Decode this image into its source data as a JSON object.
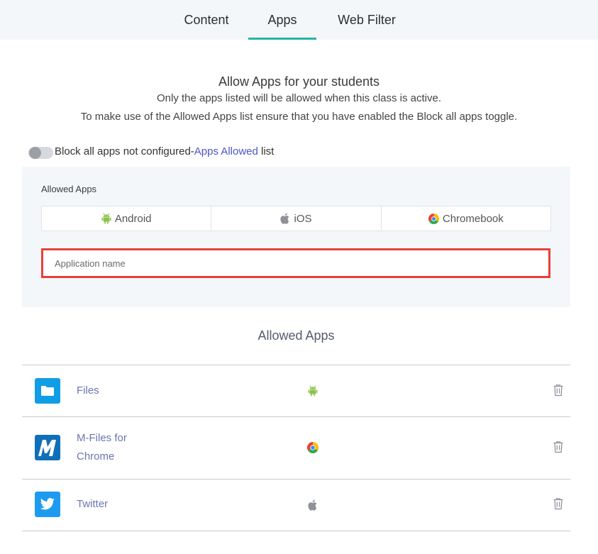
{
  "tabs": [
    {
      "label": "Content",
      "active": false
    },
    {
      "label": "Apps",
      "active": true
    },
    {
      "label": "Web Filter",
      "active": false
    }
  ],
  "colors": {
    "accent": "#25b3a8",
    "link": "#4b55c7",
    "app_name": "#6a76b0",
    "highlight_border": "#e8403a"
  },
  "intro": {
    "title": "Allow Apps for your students",
    "line1": "Only the apps listed will be allowed when this class is active.",
    "line2": "To make use of the Allowed Apps list ensure that you have enabled the Block all apps toggle."
  },
  "block_toggle": {
    "enabled": false,
    "text_before": "Block all apps not configured-",
    "link_text": "Apps Allowed",
    "text_after": " list"
  },
  "add_panel": {
    "label": "Allowed Apps",
    "platforms": [
      {
        "label": "Android",
        "icon": "android-icon"
      },
      {
        "label": "iOS",
        "icon": "apple-icon"
      },
      {
        "label": "Chromebook",
        "icon": "chrome-icon"
      }
    ],
    "input_placeholder": "Application name",
    "input_value": ""
  },
  "allowed_list": {
    "title": "Allowed Apps",
    "apps": [
      {
        "name": "Files",
        "icon": "files-folder-icon",
        "platform": "android-icon"
      },
      {
        "name": "M-Files for Chrome",
        "name_line1": "M-Files for",
        "name_line2": "Chrome",
        "icon": "m-files-icon",
        "platform": "chrome-icon"
      },
      {
        "name": "Twitter",
        "icon": "twitter-bird-icon",
        "platform": "apple-icon"
      }
    ]
  }
}
